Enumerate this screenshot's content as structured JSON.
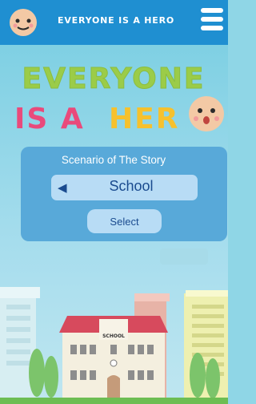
{
  "header": {
    "title": "EVERYONE IS A HERO"
  },
  "logo": {
    "line1": "EVERYONE",
    "line2_part1": "IS A",
    "line2_part2": "HER"
  },
  "panel": {
    "heading": "Scenario of The Story",
    "selected": "School",
    "button": "Select"
  },
  "scene": {
    "school_sign": "SCHOOL"
  },
  "colors": {
    "header": "#1f8fd1",
    "panel": "#58a9d9",
    "accent_green": "#9bcc48",
    "accent_pink": "#e94a7b",
    "accent_yellow": "#f6c12d"
  }
}
